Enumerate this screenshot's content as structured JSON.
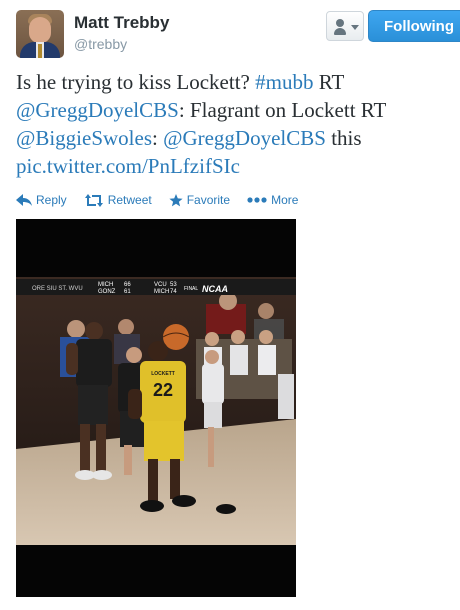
{
  "user": {
    "name": "Matt Trebby",
    "handle": "@trebby"
  },
  "buttons": {
    "user_actions_icon": "user-dropdown-icon",
    "follow_label": "Following"
  },
  "tweet": {
    "segments": [
      {
        "text": "Is he trying to kiss Lockett? ",
        "link": false
      },
      {
        "text": "#mubb",
        "link": true
      },
      {
        "text": " RT ",
        "link": false
      },
      {
        "text": "@GreggDoyelCBS",
        "link": true
      },
      {
        "text": ": Flagrant on Lockett RT ",
        "link": false
      },
      {
        "text": "@BiggieSwoles",
        "link": true
      },
      {
        "text": ": ",
        "link": false
      },
      {
        "text": "@GreggDoyelCBS",
        "link": true
      },
      {
        "text": " this ",
        "link": false
      },
      {
        "text": "pic.twitter.com/PnLfzifSIc",
        "link": true
      }
    ]
  },
  "actions": [
    {
      "label": "Reply",
      "icon": "reply-icon"
    },
    {
      "label": "Retweet",
      "icon": "retweet-icon"
    },
    {
      "label": "Favorite",
      "icon": "star-icon"
    },
    {
      "label": "More",
      "icon": "more-dots-icon"
    }
  ],
  "media": {
    "scoreboard": {
      "team1": "MICH",
      "team1_score": "66",
      "team2": "GONZ",
      "team2_score": "61",
      "team3": "VCU",
      "team3_score": "53",
      "team4": "MICH",
      "team4_score": "74",
      "final_label": "FINAL",
      "network": "NCAA"
    },
    "jersey_number": "22",
    "jersey_name": "LOCKETT"
  },
  "colors": {
    "link": "#2b7bb9",
    "follow_button": "#2a90d8",
    "name_text": "#292f33",
    "handle_text": "#8899a6"
  }
}
